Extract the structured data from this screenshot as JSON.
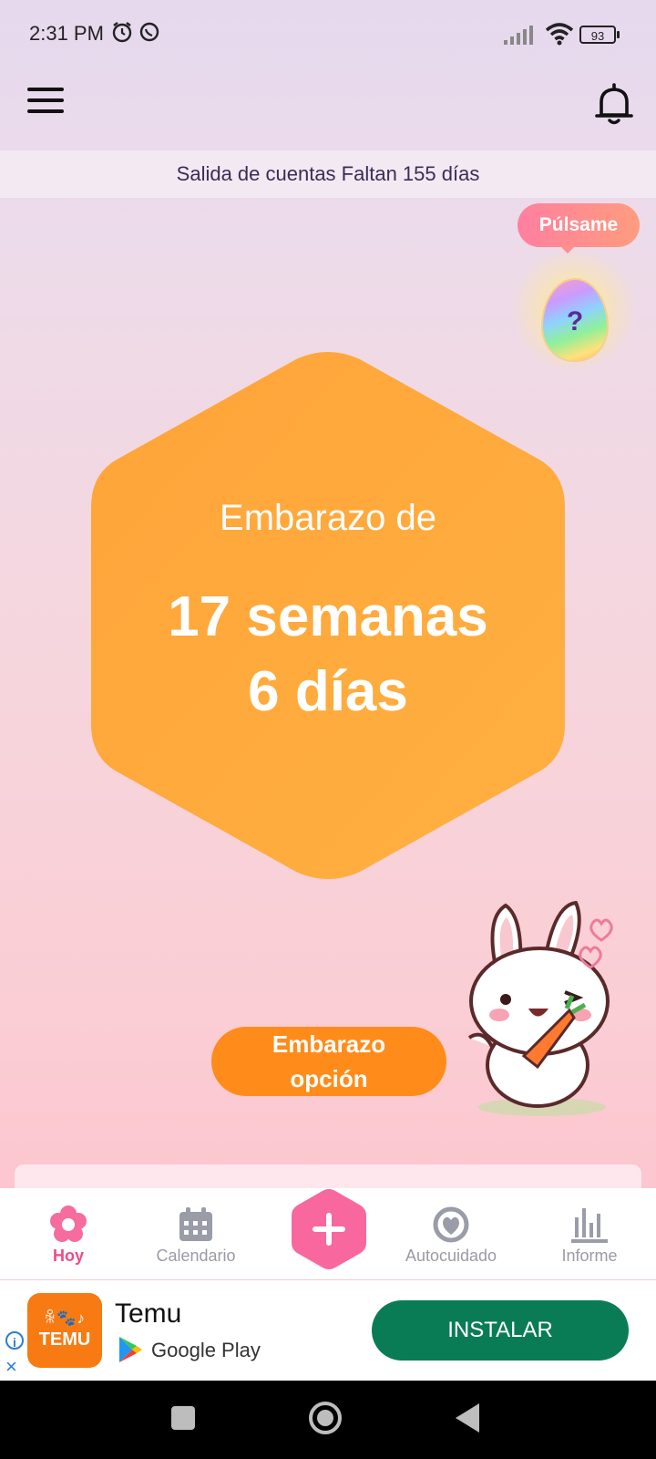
{
  "status_bar": {
    "time": "2:31 PM",
    "battery": "93"
  },
  "header": {
    "countdown_text": "Salida de cuentas Faltan 155 días"
  },
  "surprise": {
    "button_label": "Púlsame",
    "egg_symbol": "?"
  },
  "pregnancy": {
    "title": "Embarazo de",
    "weeks_text": "17 semanas",
    "days_text": "6 días",
    "option_label_line1": "Embarazo",
    "option_label_line2": "opción"
  },
  "bottom_nav": {
    "items": [
      {
        "label": "Hoy",
        "icon": "flower-icon",
        "active": true
      },
      {
        "label": "Calendario",
        "icon": "calendar-icon",
        "active": false
      },
      {
        "label": "",
        "icon": "plus-icon",
        "active": false
      },
      {
        "label": "Autocuidado",
        "icon": "heart-ring-icon",
        "active": false
      },
      {
        "label": "Informe",
        "icon": "bar-chart-icon",
        "active": false
      }
    ]
  },
  "ad": {
    "logo_line1": "ꆜ🐾♪",
    "logo_line2": "TEMU",
    "title": "Temu",
    "store": "Google Play",
    "install_label": "INSTALAR",
    "info_symbol": "i",
    "close_symbol": "×"
  },
  "colors": {
    "accent": "#f04a86",
    "hexagon": "#ffa436",
    "option_button": "#ff8c1a",
    "install_button": "#0a7c55"
  }
}
